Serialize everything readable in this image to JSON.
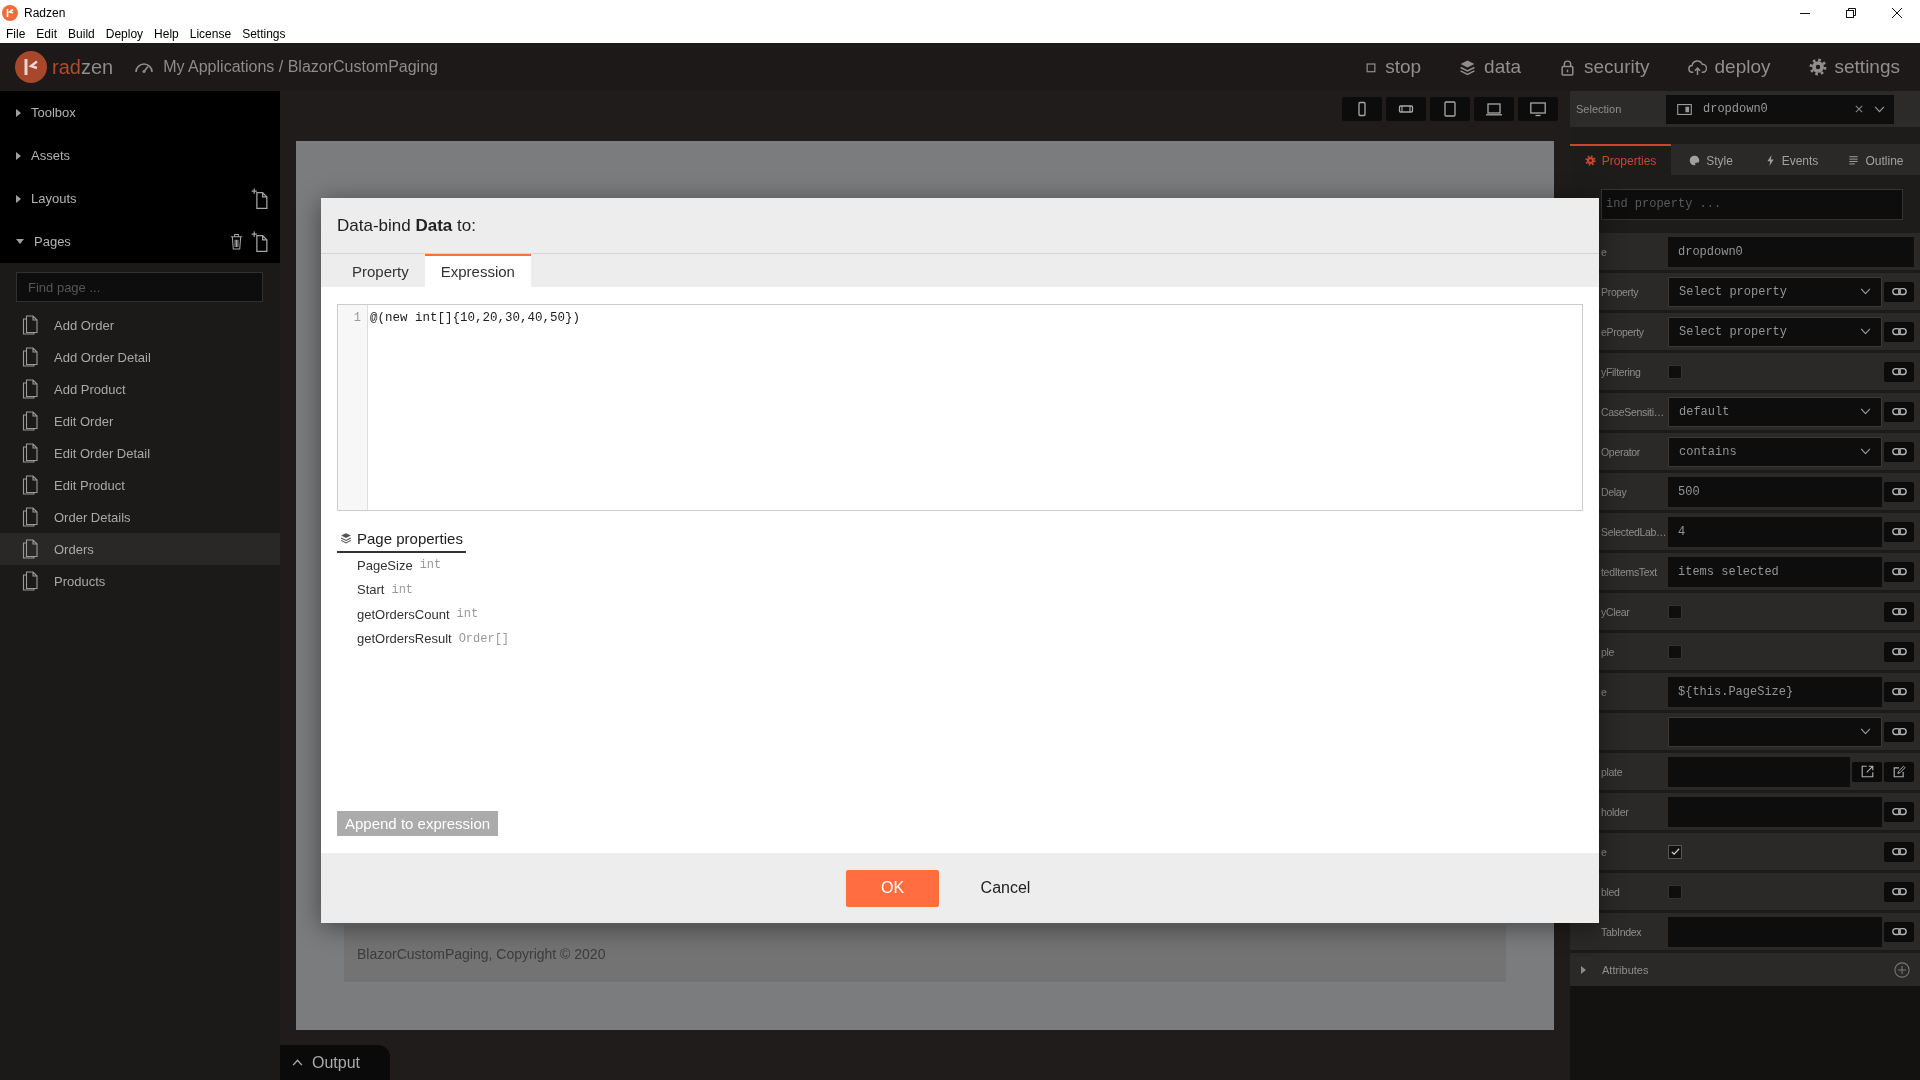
{
  "window": {
    "title": "Radzen"
  },
  "menu": [
    "File",
    "Edit",
    "Build",
    "Deploy",
    "Help",
    "License",
    "Settings"
  ],
  "topbar": {
    "logo": "radzen",
    "breadcrumb": "My Applications / BlazorCustomPaging",
    "actions": [
      {
        "kind": "stop",
        "label": "stop"
      },
      {
        "kind": "data",
        "label": "data"
      },
      {
        "kind": "security",
        "label": "security"
      },
      {
        "kind": "deploy",
        "label": "deploy"
      },
      {
        "kind": "settings",
        "label": "settings"
      }
    ]
  },
  "sidebar": {
    "sections": [
      {
        "label": "Toolbox",
        "expanded": false
      },
      {
        "label": "Assets",
        "expanded": false
      },
      {
        "label": "Layouts",
        "expanded": false,
        "tools": [
          {
            "kind": "add"
          }
        ]
      },
      {
        "label": "Pages",
        "expanded": true,
        "tools": [
          {
            "kind": "delete"
          },
          {
            "kind": "add"
          }
        ],
        "search": {
          "placeholder": "Find page ..."
        },
        "items": [
          {
            "label": "Add Order",
            "selected": false
          },
          {
            "label": "Add Order Detail",
            "selected": false
          },
          {
            "label": "Add Product",
            "selected": false
          },
          {
            "label": "Edit Order",
            "selected": false
          },
          {
            "label": "Edit Order Detail",
            "selected": false
          },
          {
            "label": "Edit Product",
            "selected": false
          },
          {
            "label": "Order Details",
            "selected": false
          },
          {
            "label": "Orders",
            "selected": true
          },
          {
            "label": "Products",
            "selected": false
          }
        ]
      }
    ]
  },
  "canvas": {
    "preview": {
      "footer": "BlazorCustomPaging, Copyright © 2020"
    },
    "output_tab": {
      "label": "Output"
    }
  },
  "dialog": {
    "title": "Data-bind **Data** to:",
    "tabs": [
      {
        "label": "Property",
        "selected": false
      },
      {
        "label": "Expression",
        "selected": true
      }
    ],
    "editor": {
      "lines": [
        {
          "number": "1",
          "code": "@(new int[]{10,20,30,40,50})"
        }
      ]
    },
    "page_properties": {
      "title": "Page properties",
      "items": [
        {
          "name": "PageSize",
          "type": "int"
        },
        {
          "name": "Start",
          "type": "int"
        },
        {
          "name": "getOrdersCount",
          "type": "int"
        },
        {
          "name": "getOrdersResult",
          "type": "Order[]"
        }
      ]
    },
    "append_button": {
      "label": "Append to expression"
    },
    "buttons": [
      {
        "kind": "primary",
        "label": "OK"
      },
      {
        "kind": "secondary",
        "label": "Cancel"
      }
    ]
  },
  "properties_panel": {
    "selection": {
      "label": "Selection",
      "value": "dropdown0"
    },
    "tabs": [
      {
        "kind": "properties",
        "label": "Properties",
        "selected": true
      },
      {
        "kind": "style",
        "label": "Style",
        "selected": false
      },
      {
        "kind": "events",
        "label": "Events",
        "selected": false
      },
      {
        "kind": "outline",
        "label": "Outline",
        "selected": false
      }
    ],
    "search": {
      "placeholder": "ind property ..."
    },
    "rows": [
      {
        "label": "e",
        "kind": "wide",
        "value": "dropdown0"
      },
      {
        "label": "Property",
        "kind": "select",
        "value": "Select property"
      },
      {
        "label": "eProperty",
        "kind": "select",
        "value": "Select property"
      },
      {
        "label": "yFiltering",
        "kind": "checkbox",
        "checked": false
      },
      {
        "label": "CaseSensiti…",
        "kind": "select",
        "value": "default"
      },
      {
        "label": "Operator",
        "kind": "select",
        "value": "contains"
      },
      {
        "label": "Delay",
        "kind": "text",
        "value": "500"
      },
      {
        "label": "SelectedLab…",
        "kind": "text",
        "value": "4"
      },
      {
        "label": "tedItemsText",
        "kind": "text",
        "value": "items selected"
      },
      {
        "label": "yClear",
        "kind": "checkbox",
        "checked": false
      },
      {
        "label": "ple",
        "kind": "checkbox",
        "checked": false
      },
      {
        "label": "e",
        "kind": "text",
        "value": "${this.PageSize}"
      },
      {
        "kind": "select"
      },
      {
        "label": "plate",
        "kind": "template"
      },
      {
        "label": "holder",
        "kind": "text"
      },
      {
        "label": "e",
        "kind": "checkbox",
        "checked": true
      },
      {
        "label": "bled",
        "kind": "checkbox",
        "checked": false
      },
      {
        "label": "TabIndex",
        "kind": "text"
      }
    ],
    "attributes": {
      "label": "Attributes",
      "expanded": false
    }
  }
}
